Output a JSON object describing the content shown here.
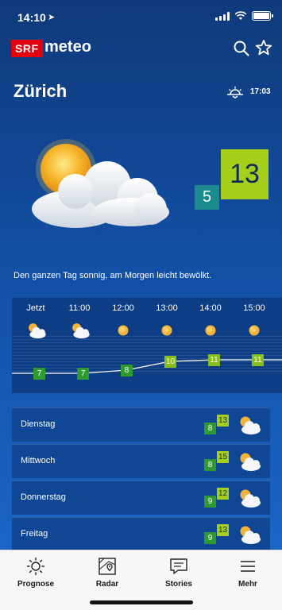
{
  "status_bar": {
    "time": "14:10"
  },
  "header": {
    "app_name": "meteo",
    "logo_text": "SRF"
  },
  "location": {
    "city": "Zürich",
    "sunset_time": "17:03"
  },
  "today": {
    "temp_max": "13",
    "temp_min": "5",
    "summary": "Den ganzen Tag sonnig, am Morgen leicht bewölkt."
  },
  "hourly": [
    {
      "time": "Jetzt",
      "temp": "7",
      "icon": "sun-cloud-icon"
    },
    {
      "time": "11:00",
      "temp": "7",
      "icon": "sun-cloud-icon"
    },
    {
      "time": "12:00",
      "temp": "8",
      "icon": "sun-icon"
    },
    {
      "time": "13:00",
      "temp": "10",
      "icon": "sun-icon"
    },
    {
      "time": "14:00",
      "temp": "11",
      "icon": "sun-icon"
    },
    {
      "time": "15:00",
      "temp": "11",
      "icon": "sun-icon"
    }
  ],
  "daily": [
    {
      "day": "Dienstag",
      "min": "8",
      "max": "13",
      "icon": "sun-cloud-icon"
    },
    {
      "day": "Mittwoch",
      "min": "8",
      "max": "15",
      "icon": "sun-cloud-icon"
    },
    {
      "day": "Donnerstag",
      "min": "9",
      "max": "12",
      "icon": "sun-cloud-icon"
    },
    {
      "day": "Freitag",
      "min": "9",
      "max": "13",
      "icon": "sun-cloud-icon"
    }
  ],
  "tabs": [
    {
      "label": "Prognose",
      "icon": "sun-outline-icon"
    },
    {
      "label": "Radar",
      "icon": "map-pin-icon"
    },
    {
      "label": "Stories",
      "icon": "chat-bubble-icon"
    },
    {
      "label": "Mehr",
      "icon": "menu-icon"
    }
  ],
  "colors": {
    "brand_red": "#e3000f",
    "temp_max": "#a6cf1b",
    "temp_min": "#1b8a8a",
    "hour_temp": "#2f9a2f"
  }
}
